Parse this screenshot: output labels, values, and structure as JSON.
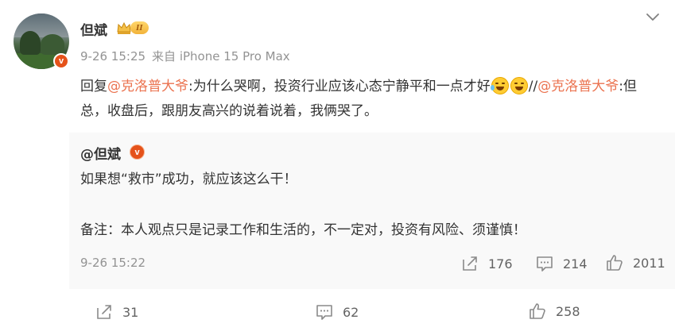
{
  "post": {
    "author_name": "但斌",
    "level_badge": "II",
    "verified_mark": "v",
    "time": "9-26 15:25",
    "source": "来自 iPhone 15 Pro Max",
    "body": {
      "reply_prefix": "回复",
      "mention1": "@克洛普大爷",
      "text1": ":为什么哭啊，投资行业应该心态宁静平和一点才好",
      "separator": "//",
      "mention2": "@克洛普大爷",
      "text2": ":但总，收盘后，跟朋友高兴的说着说着，我俩哭了。",
      "emojis": [
        "crying-laugh-emoji",
        "laugh-emoji"
      ]
    }
  },
  "quoted_post": {
    "author": "@但斌",
    "verified_mark": "v",
    "line1": "如果想“救市”成功，就应该这么干！",
    "line2": "备注：本人观点只是记录工作和生活的，不一定对，投资有风险、须谨慎！",
    "time": "9-26 15:22",
    "repost_count": "176",
    "comment_count": "214",
    "like_count": "2011"
  },
  "post_actions": {
    "repost_count": "31",
    "comment_count": "62",
    "like_count": "258"
  },
  "icons": [
    "menu-chevron-icon",
    "crown-icon",
    "repost-icon",
    "comment-icon",
    "like-icon"
  ],
  "colors": {
    "mention": "#eb7350",
    "meta": "#939393",
    "verified": "#e5521a",
    "quote_bg": "#f9f9f9"
  }
}
